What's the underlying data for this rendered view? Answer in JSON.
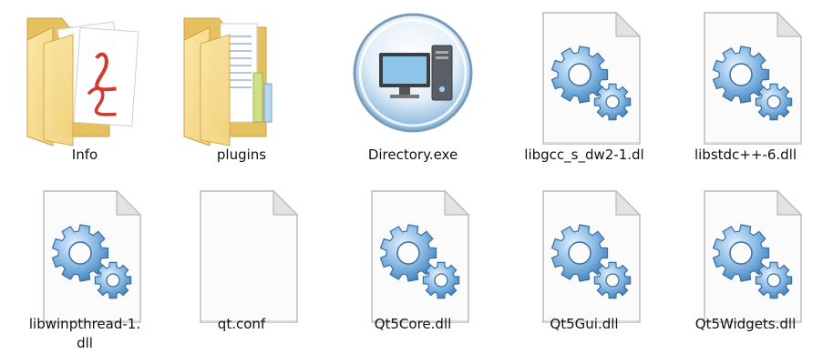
{
  "window": {
    "view": "large-icons",
    "background": "#ffffff"
  },
  "files": [
    {
      "name": "Info",
      "kind": "folder-pdf",
      "icon": "folder-with-pdf-icon"
    },
    {
      "name": "plugins",
      "kind": "folder-docs",
      "icon": "folder-with-documents-icon"
    },
    {
      "name": "Directory.exe",
      "kind": "exe",
      "icon": "computer-application-icon"
    },
    {
      "name": "libgcc_s_dw2-1.dl",
      "kind": "dll",
      "icon": "dll-gears-icon"
    },
    {
      "name": "libstdc++-6.dll",
      "kind": "dll",
      "icon": "dll-gears-icon"
    },
    {
      "name": "libwinpthread-1.\ndll",
      "kind": "dll",
      "icon": "dll-gears-icon"
    },
    {
      "name": "qt.conf",
      "kind": "blank",
      "icon": "blank-document-icon"
    },
    {
      "name": "Qt5Core.dll",
      "kind": "dll",
      "icon": "dll-gears-icon"
    },
    {
      "name": "Qt5Gui.dll",
      "kind": "dll",
      "icon": "dll-gears-icon"
    },
    {
      "name": "Qt5Widgets.dll",
      "kind": "dll",
      "icon": "dll-gears-icon"
    }
  ],
  "colors": {
    "folder": "#f2d27a",
    "gear": "#7fb3e0",
    "pdf_red": "#d03a2e",
    "label_text": "#111111"
  }
}
